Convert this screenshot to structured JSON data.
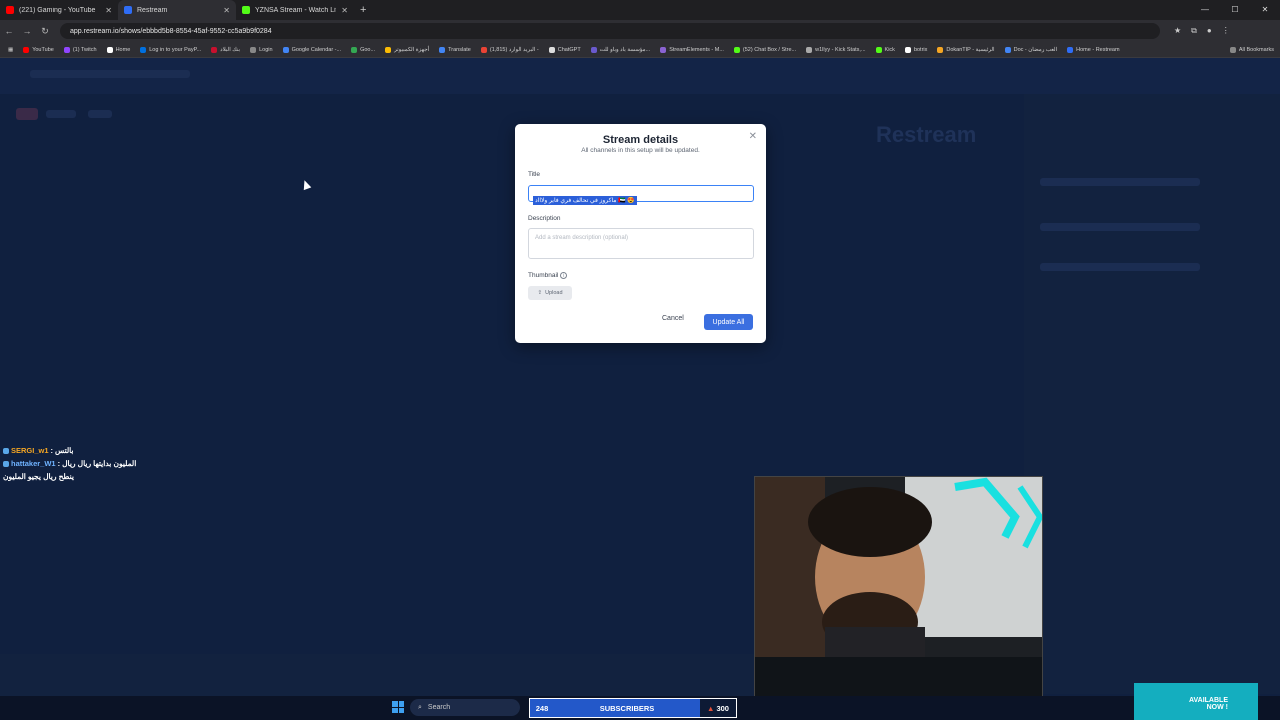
{
  "browser": {
    "tabs": [
      {
        "label": "(221) Gaming - YouTube",
        "color": "#ff0000"
      },
      {
        "label": "Restream",
        "color": "#2f6df6"
      },
      {
        "label": "YZNSA Stream - Watch Live on",
        "color": "#53fc18"
      }
    ],
    "url": "app.restream.io/shows/ebbbd5b8-8554-45af-9552-cc5a9b9f0284",
    "bookmarks": [
      {
        "label": "YouTube",
        "color": "#ff0000"
      },
      {
        "label": "(1) Twitch",
        "color": "#9146ff"
      },
      {
        "label": "Home",
        "color": "#ffffff"
      },
      {
        "label": "Log in to your PayP...",
        "color": "#0070e0"
      },
      {
        "label": "بنك البلاد",
        "color": "#c8102e"
      },
      {
        "label": "Login",
        "color": "#888888"
      },
      {
        "label": "Google Calendar -...",
        "color": "#4285f4"
      },
      {
        "label": "Goo...",
        "color": "#34a853"
      },
      {
        "label": "أجهزة الكمبيوتر",
        "color": "#fbbc05"
      },
      {
        "label": "Translate",
        "color": "#4285f4"
      },
      {
        "label": "(1,815) البريد الوارد -",
        "color": "#ea4335"
      },
      {
        "label": "ChatGPT",
        "color": "#dddddd"
      },
      {
        "label": "مؤسسة باد وباو للت...",
        "color": "#6a5acd"
      },
      {
        "label": "StreamElements - M...",
        "color": "#8a63d2"
      },
      {
        "label": "(52) Chat Box / Stre...",
        "color": "#53fc18"
      },
      {
        "label": "w1llyy - Kick Stats,...",
        "color": "#aaaaaa"
      },
      {
        "label": "Kick",
        "color": "#53fc18"
      },
      {
        "label": "botrix",
        "color": "#ffffff"
      },
      {
        "label": "DokanTIP - الرئيسية",
        "color": "#f5a623"
      },
      {
        "label": "Doc - العب رمضان",
        "color": "#4285f4"
      },
      {
        "label": "Home - Restream",
        "color": "#2f6df6"
      }
    ],
    "all_bookmarks": "All Bookmarks"
  },
  "modal": {
    "title": "Stream details",
    "subtitle": "All channels in this setup will be updated.",
    "title_label": "Title",
    "title_value": "😍 🇦🇪 ماكروز في تحالف فري فاير ولاااد",
    "description_label": "Description",
    "description_placeholder": "Add a stream description (optional)",
    "thumbnail_label": "Thumbnail",
    "upload_label": "Upload",
    "cancel_label": "Cancel",
    "update_label": "Update All"
  },
  "page": {
    "brand": "Restream"
  },
  "chat": [
    {
      "user": "SERGI_w1",
      "message": "بالتس",
      "user_color": "#f5a623"
    },
    {
      "user": "hattaker_W1",
      "message": "المليون بدايتها ريال ريال",
      "user_color": "#6fb3ff"
    },
    {
      "user": "",
      "message": "ينطح ريال يجيو المليون",
      "user_color": "#ffffff"
    }
  ],
  "taskbar": {
    "search_label": "Search"
  },
  "subscribers": {
    "count": "248",
    "label": "SUBSCRIBERS",
    "goal": "300"
  },
  "promo": {
    "text_line1": "AVAILABLE",
    "text_line2": "NOW !"
  }
}
